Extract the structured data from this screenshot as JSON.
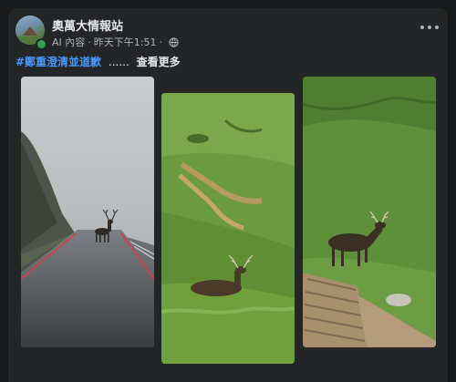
{
  "post": {
    "author": "奧萬大情報站",
    "meta": {
      "ai_label": "AI 內容",
      "timestamp": "昨天下午1:51",
      "separator": "·",
      "privacy_icon": "globe-icon"
    },
    "menu_icon": "more-horizontal-icon",
    "caption": {
      "hashtag": "#鄭重澄清並道歉",
      "ellipsis": "......",
      "see_more": "查看更多"
    },
    "photos": [
      {
        "subject": "deer-on-foggy-road"
      },
      {
        "subject": "deer-in-grass-field"
      },
      {
        "subject": "deer-walking-on-grassy-slope"
      }
    ]
  },
  "colors": {
    "page_bg": "#18191a",
    "card_bg": "#242526",
    "primary_text": "#e4e6eb",
    "secondary_text": "#b0b3b8",
    "hashtag": "#4599ff",
    "online": "#31a24c"
  }
}
